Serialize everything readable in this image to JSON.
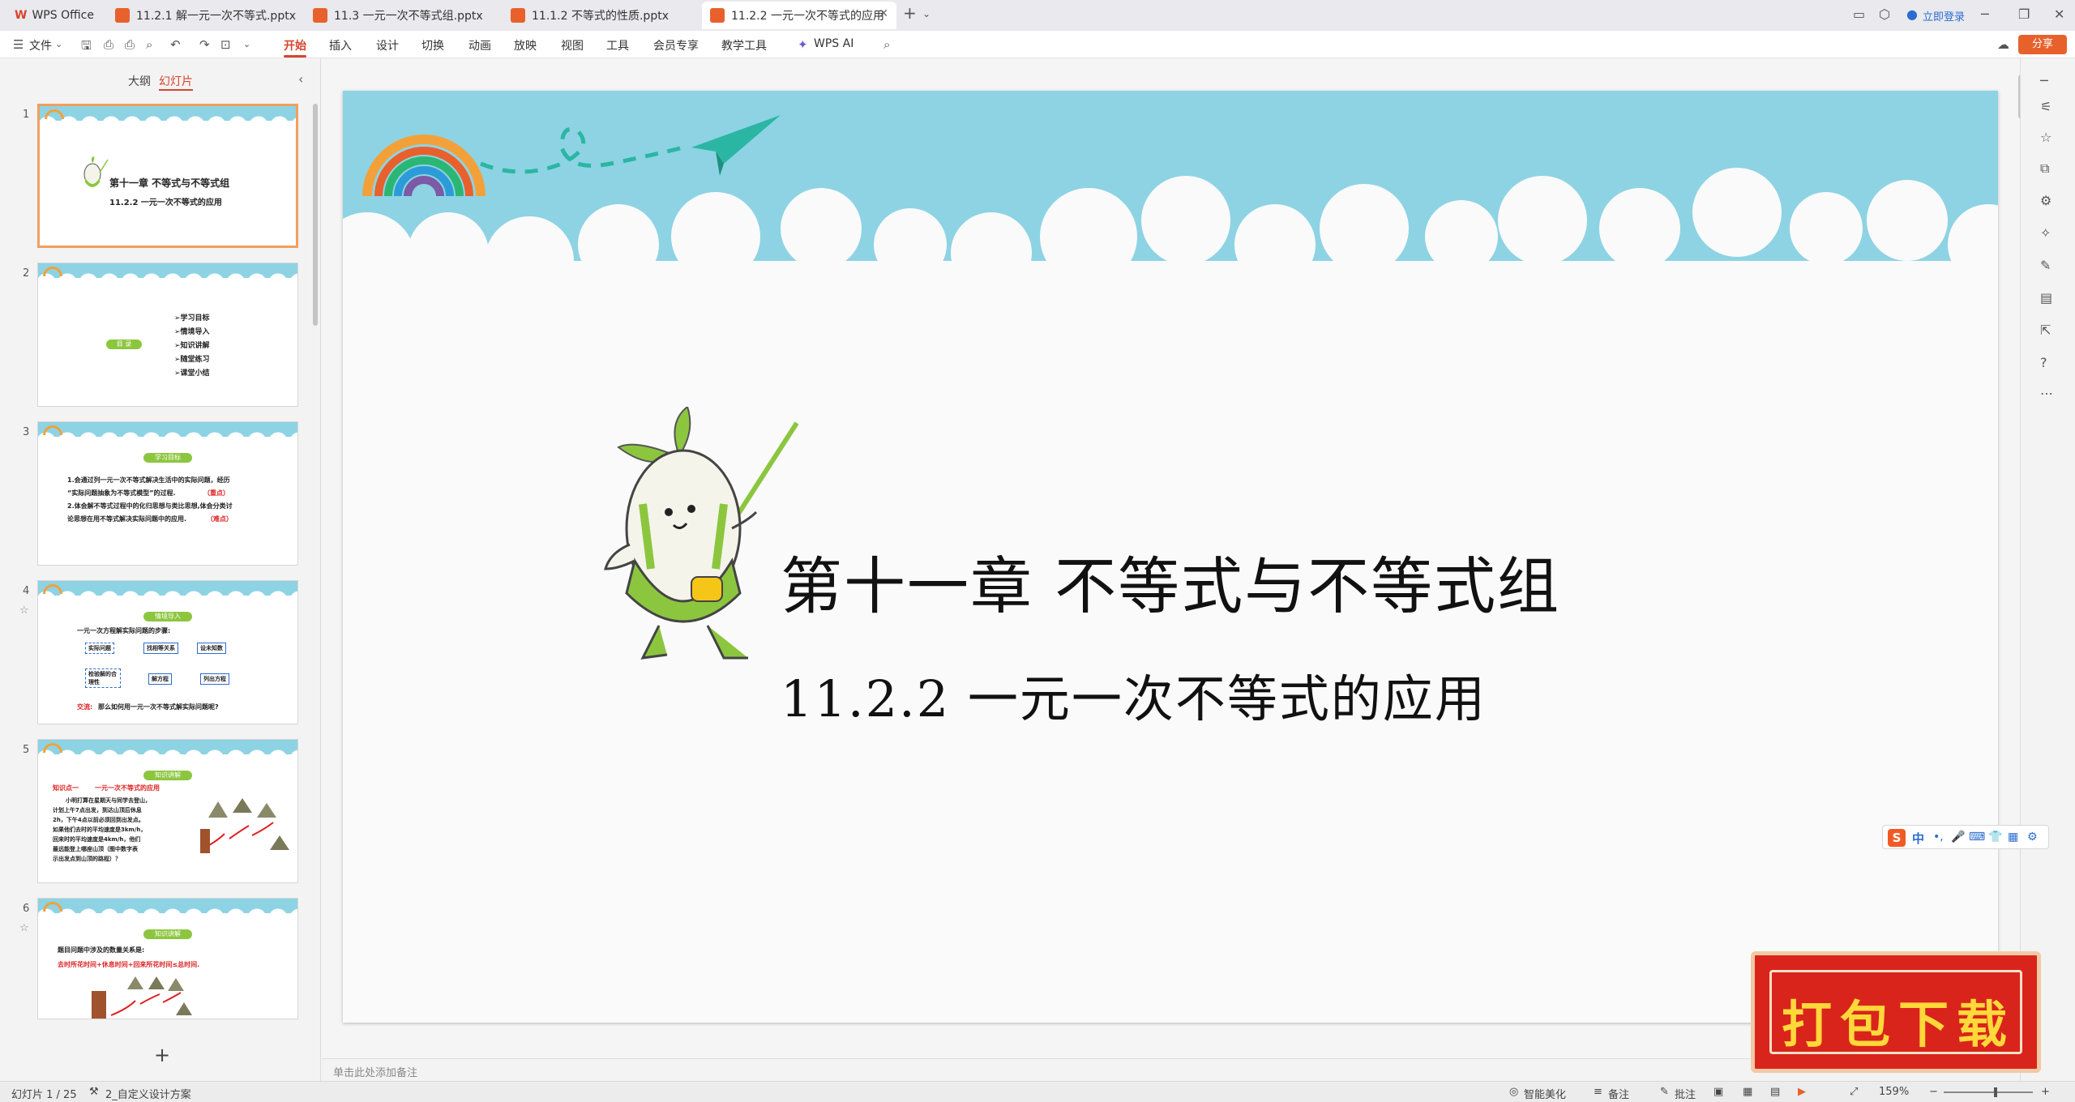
{
  "tabs": [
    {
      "label": "WPS Office",
      "icon": "wps-logo-icon",
      "color": "#d8442b"
    },
    {
      "label": "11.2.1  解一元一次不等式.pptx",
      "icon": "pptx-file-icon",
      "color": "#e8612c"
    },
    {
      "label": "11.3  一元一次不等式组.pptx",
      "icon": "pptx-file-icon",
      "color": "#e8612c"
    },
    {
      "label": "11.1.2  不等式的性质.pptx",
      "icon": "pptx-file-icon",
      "color": "#e8612c"
    },
    {
      "label": "11.2.2  一元一次不等式的应用",
      "icon": "pptx-file-icon",
      "color": "#e8612c"
    }
  ],
  "titlebar": {
    "login_label": "立即登录",
    "share_label": "分享"
  },
  "menu": {
    "file_label": "文件",
    "items": [
      "开始",
      "插入",
      "设计",
      "切换",
      "动画",
      "放映",
      "视图",
      "工具",
      "会员专享",
      "教学工具",
      "WPS AI"
    ],
    "active": "开始"
  },
  "leftpanel": {
    "tab_outline": "大纲",
    "tab_slides": "幻灯片",
    "thumbnails": [
      {
        "num": "1",
        "title": "第十一章  不等式与不等式组",
        "subtitle": "11.2.2   一元一次不等式的应用"
      },
      {
        "num": "2",
        "badge": "目 录",
        "lines": [
          "➢学习目标",
          "➢情境导入",
          "➢知识讲解",
          "➢随堂练习",
          "➢课堂小结"
        ]
      },
      {
        "num": "3",
        "badge": "学习目标",
        "lines": [
          "1.会通过列一元一次不等式解决生活中的实际问题，经历",
          "“实际问题抽象为不等式模型”的过程.",
          "（重点）",
          "2.体会解不等式过程中的化归思想与类比思想,体会分类讨",
          "论思想在用不等式解决实际问题中的应用.",
          "（难点）"
        ]
      },
      {
        "num": "4",
        "badge": "情境导入",
        "lines": [
          "一元一次方程解实际问题的步骤:",
          "实际问题",
          "找相等关系",
          "设未知数",
          "检验解的合理性",
          "解方程",
          "列出方程",
          "交流:",
          "那么如何用一元一次不等式解实际问题呢?"
        ]
      },
      {
        "num": "5",
        "badge": "知识讲解",
        "lines": [
          "知识点一",
          "一元一次不等式的应用",
          "小明打算在星期天与同学去登山，",
          "计划上午7点出发，到达山顶后休息",
          "2h，下午4点以前必须回到出发点。",
          "如果他们去时的平均速度是3km/h，",
          "回来时的平均速度是4km/h，他们",
          "最远能登上哪座山顶（图中数字表",
          "示出发点到山顶的路程）？"
        ]
      },
      {
        "num": "6",
        "badge": "知识讲解",
        "lines": [
          "题目问题中涉及的数量关系是:",
          "去时所花时间+休息时间+回来所花时间≤总时间."
        ]
      }
    ]
  },
  "slide": {
    "title": "第十一章  不等式与不等式组",
    "subtitle": "11.2.2   一元一次不等式的应用"
  },
  "notes_placeholder": "单击此处添加备注",
  "status": {
    "slide_counter": "幻灯片 1 / 25",
    "design": "2_自定义设计方案",
    "beautify": "智能美化",
    "notes": "备注",
    "comments": "批注",
    "zoom": "159%"
  },
  "ime": {
    "lang": "中"
  },
  "download_badge": "打包下载",
  "colors": {
    "accent": "#d8442b",
    "sky": "#8dd3e4",
    "leaf_green": "#8cc63f",
    "badge_red": "#d9241c",
    "badge_text": "#ffd83a"
  }
}
